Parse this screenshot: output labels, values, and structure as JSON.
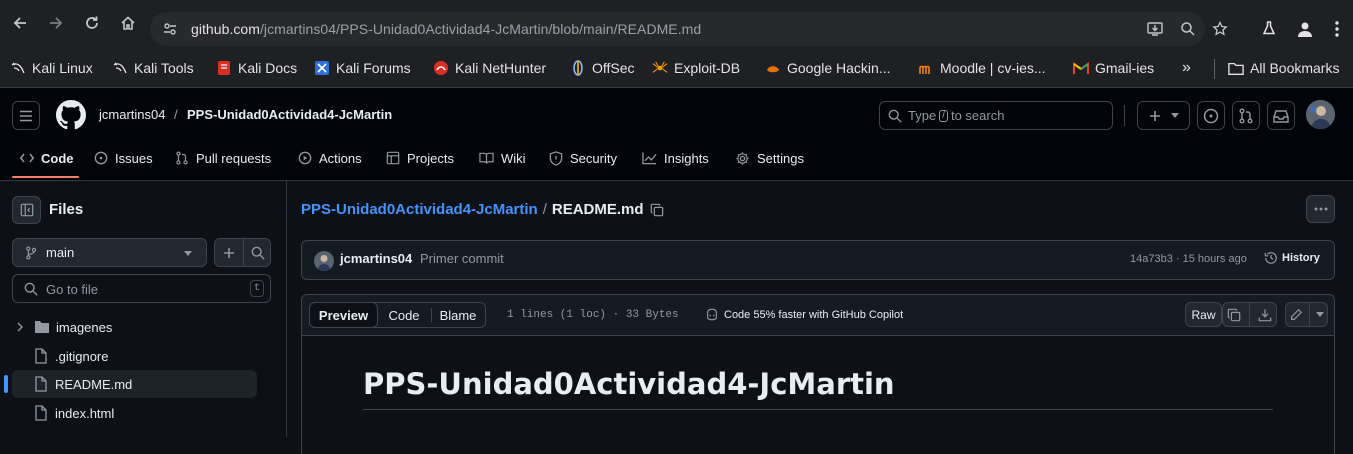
{
  "browser": {
    "url_host": "github.com",
    "url_path": "/jcmartins04/PPS-Unidad0Actividad4-JcMartin/blob/main/README.md",
    "bookmarks": [
      {
        "label": "Kali Linux",
        "icon": "kali-dragon-icon"
      },
      {
        "label": "Kali Tools",
        "icon": "kali-dragon-icon"
      },
      {
        "label": "Kali Docs",
        "icon": "kali-docs-icon"
      },
      {
        "label": "Kali Forums",
        "icon": "kali-forums-icon"
      },
      {
        "label": "Kali NetHunter",
        "icon": "nethunter-icon"
      },
      {
        "label": "OffSec",
        "icon": "offsec-icon"
      },
      {
        "label": "Exploit-DB",
        "icon": "exploitdb-spider-icon"
      },
      {
        "label": "Google Hackin...",
        "icon": "ghdb-icon"
      },
      {
        "label": "Moodle | cv-ies...",
        "icon": "moodle-icon"
      },
      {
        "label": "Gmail-ies",
        "icon": "gmail-icon"
      }
    ],
    "overflow_label": "»",
    "all_bookmarks_label": "All Bookmarks"
  },
  "header": {
    "owner": "jcmartins04",
    "separator": "/",
    "repo": "PPS-Unidad0Actividad4-JcMartin",
    "search_prefix": "Type",
    "search_key": "/",
    "search_suffix": "to search"
  },
  "tabs": [
    {
      "label": "Code",
      "icon": "code-icon"
    },
    {
      "label": "Issues",
      "icon": "issue-opened-icon"
    },
    {
      "label": "Pull requests",
      "icon": "git-pull-request-icon"
    },
    {
      "label": "Actions",
      "icon": "play-icon"
    },
    {
      "label": "Projects",
      "icon": "table-icon"
    },
    {
      "label": "Wiki",
      "icon": "book-icon"
    },
    {
      "label": "Security",
      "icon": "shield-icon"
    },
    {
      "label": "Insights",
      "icon": "graph-icon"
    },
    {
      "label": "Settings",
      "icon": "gear-icon"
    }
  ],
  "sidebar": {
    "title": "Files",
    "branch": "main",
    "go_to_file_placeholder": "Go to file",
    "go_to_file_key": "t",
    "tree": [
      {
        "name": "imagenes",
        "type": "folder",
        "active": false
      },
      {
        "name": ".gitignore",
        "type": "file",
        "active": false
      },
      {
        "name": "README.md",
        "type": "file",
        "active": true
      },
      {
        "name": "index.html",
        "type": "file",
        "active": false
      }
    ]
  },
  "main": {
    "breadcrumb_repo": "PPS-Unidad0Actividad4-JcMartin",
    "breadcrumb_sep": "/",
    "breadcrumb_file": "README.md",
    "commit_author": "jcmartins04",
    "commit_message": "Primer commit",
    "commit_meta": "14a73b3 · 15 hours ago",
    "history_label": "History",
    "view_tabs": [
      "Preview",
      "Code",
      "Blame"
    ],
    "file_stats": "1 lines (1 loc) · 33 Bytes",
    "copilot_text": "Code 55% faster with GitHub Copilot",
    "raw_label": "Raw",
    "readme_heading": "PPS-Unidad0Actividad4-JcMartin"
  },
  "colors": {
    "accent_link": "#4493f8",
    "tab_underline": "#f78166",
    "background": "#0d1117"
  }
}
